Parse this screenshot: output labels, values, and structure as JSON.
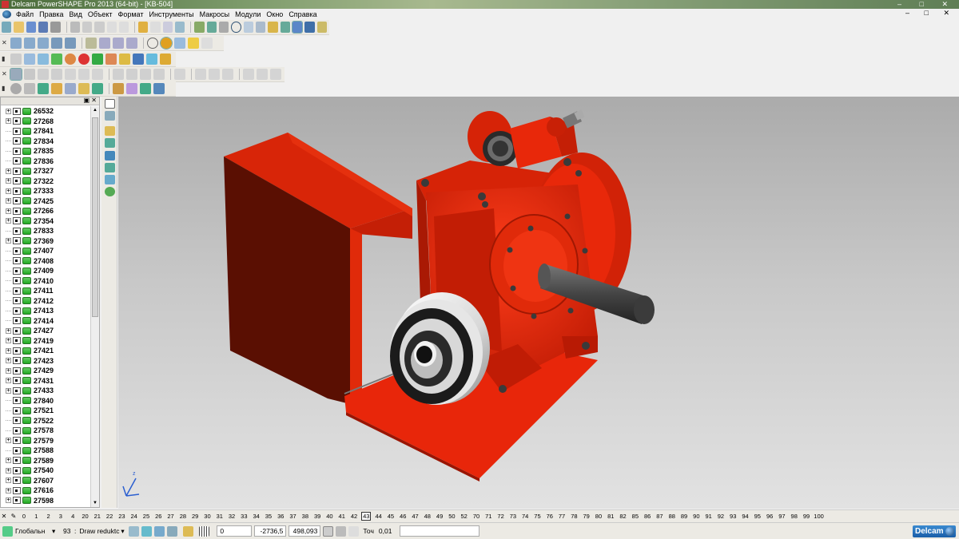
{
  "window": {
    "title": "Delcam PowerSHAPE Pro 2013 (64-bit) - [KB-504]"
  },
  "menu": {
    "items": [
      "Файл",
      "Правка",
      "Вид",
      "Объект",
      "Формат",
      "Инструменты",
      "Макросы",
      "Модули",
      "Окно",
      "Справка"
    ]
  },
  "tree": {
    "items": [
      {
        "label": "26532",
        "expandable": true
      },
      {
        "label": "27268",
        "expandable": true
      },
      {
        "label": "27841",
        "expandable": false
      },
      {
        "label": "27834",
        "expandable": false
      },
      {
        "label": "27835",
        "expandable": false
      },
      {
        "label": "27836",
        "expandable": false
      },
      {
        "label": "27327",
        "expandable": true
      },
      {
        "label": "27322",
        "expandable": true
      },
      {
        "label": "27333",
        "expandable": true
      },
      {
        "label": "27425",
        "expandable": true
      },
      {
        "label": "27266",
        "expandable": true
      },
      {
        "label": "27354",
        "expandable": true
      },
      {
        "label": "27833",
        "expandable": false
      },
      {
        "label": "27369",
        "expandable": true
      },
      {
        "label": "27407",
        "expandable": false
      },
      {
        "label": "27408",
        "expandable": false
      },
      {
        "label": "27409",
        "expandable": false
      },
      {
        "label": "27410",
        "expandable": false
      },
      {
        "label": "27411",
        "expandable": false
      },
      {
        "label": "27412",
        "expandable": false
      },
      {
        "label": "27413",
        "expandable": false
      },
      {
        "label": "27414",
        "expandable": false
      },
      {
        "label": "27427",
        "expandable": true
      },
      {
        "label": "27419",
        "expandable": true
      },
      {
        "label": "27421",
        "expandable": true
      },
      {
        "label": "27423",
        "expandable": true
      },
      {
        "label": "27429",
        "expandable": true
      },
      {
        "label": "27431",
        "expandable": true
      },
      {
        "label": "27433",
        "expandable": true
      },
      {
        "label": "27840",
        "expandable": false
      },
      {
        "label": "27521",
        "expandable": false
      },
      {
        "label": "27522",
        "expandable": false
      },
      {
        "label": "27578",
        "expandable": false
      },
      {
        "label": "27579",
        "expandable": true
      },
      {
        "label": "27588",
        "expandable": false
      },
      {
        "label": "27589",
        "expandable": true
      },
      {
        "label": "27540",
        "expandable": true
      },
      {
        "label": "27607",
        "expandable": true
      },
      {
        "label": "27616",
        "expandable": true
      },
      {
        "label": "27598",
        "expandable": true
      }
    ]
  },
  "levels": {
    "values": [
      "0",
      "1",
      "2",
      "3",
      "4",
      "20",
      "21",
      "22",
      "23",
      "24",
      "25",
      "26",
      "27",
      "28",
      "29",
      "30",
      "31",
      "32",
      "33",
      "34",
      "35",
      "36",
      "37",
      "38",
      "39",
      "40",
      "41",
      "42",
      "43",
      "44",
      "45",
      "46",
      "47",
      "48",
      "49",
      "50",
      "52",
      "70",
      "71",
      "72",
      "73",
      "74",
      "75",
      "76",
      "77",
      "78",
      "79",
      "80",
      "81",
      "82",
      "85",
      "86",
      "87",
      "88",
      "89",
      "90",
      "91",
      "92",
      "93",
      "94",
      "95",
      "96",
      "97",
      "98",
      "99",
      "100"
    ],
    "selected": "43"
  },
  "status": {
    "workplane": "Глобальн",
    "level_number": "93",
    "level_name": "Draw reduktc",
    "x": "0",
    "y": "-2736,5",
    "z": "498,093",
    "tolerance_label": "Точ",
    "tolerance": "0,01",
    "brand": "Delcam"
  },
  "colors": {
    "model_red": "#e8260a",
    "model_dark_red": "#b51a05",
    "shaft_gray": "#555555",
    "pulley_light": "#f0f0f0"
  },
  "icons": {
    "titlebar": "delcam-app-icon",
    "tree_item": [
      "solid-icon",
      "assembly-icon"
    ]
  }
}
